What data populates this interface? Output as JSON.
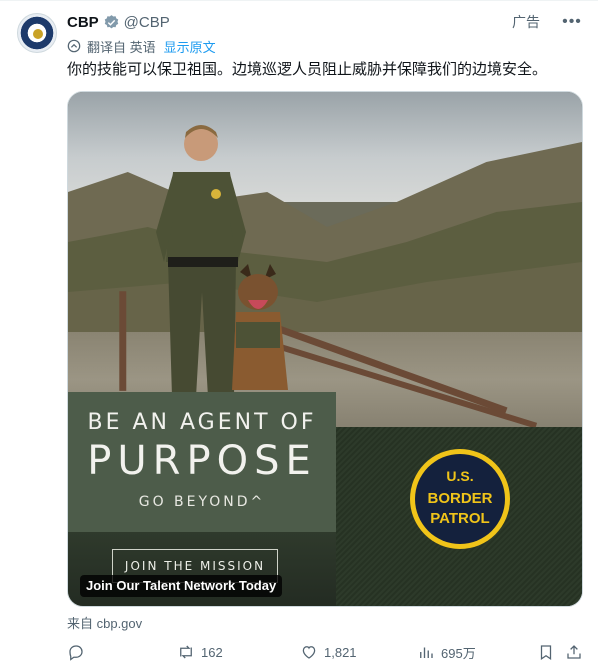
{
  "tweet": {
    "name": "CBP",
    "handle": "@CBP",
    "ad_label": "广告",
    "translate": {
      "label": "翻译自 英语",
      "show_original": "显示原文"
    },
    "text": "你的技能可以保卫祖国。边境巡逻人员阻止威胁并保障我们的边境安全。",
    "media": {
      "headline_line1": "BE AN AGENT OF",
      "headline_line2": "PURPOSE",
      "headline_line3": "GO BEYOND^",
      "cta_button": "JOIN THE MISSION",
      "caption": "Join Our Talent Network Today",
      "badge_line1": "U.S.",
      "badge_line2": "BORDER",
      "badge_line3": "PATROL"
    },
    "source": "来自 cbp.gov",
    "actions": {
      "retweets": "162",
      "likes": "1,821",
      "views": "695万"
    }
  },
  "colors": {
    "accent": "#1d9bf0",
    "text_secondary": "#536471",
    "panel_green": "#4d5c4a",
    "badge_navy": "#14213d",
    "badge_gold": "#f0c419"
  },
  "icons": [
    "verified-badge-icon",
    "translate-icon",
    "more-icon",
    "reply-icon",
    "retweet-icon",
    "like-icon",
    "views-icon",
    "bookmark-icon",
    "share-icon"
  ]
}
